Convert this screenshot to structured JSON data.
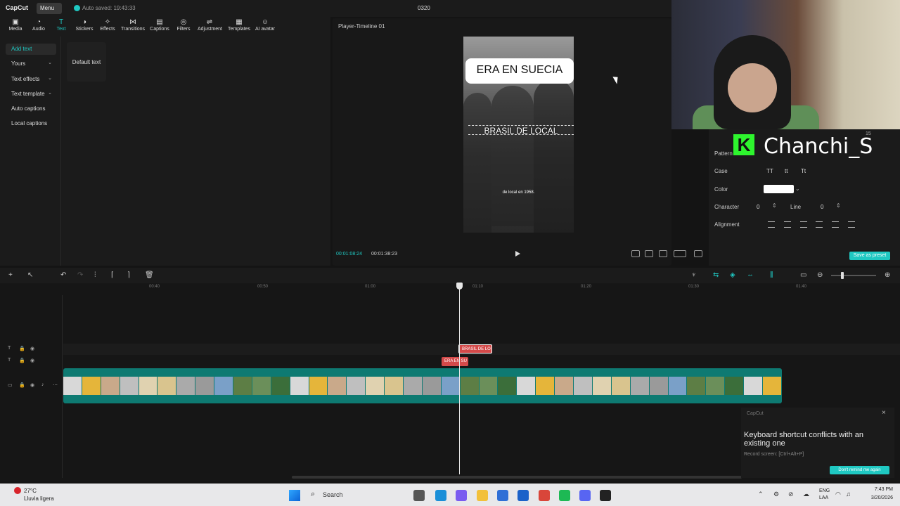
{
  "titlebar": {
    "logo": "CapCut",
    "menu_label": "Menu",
    "autosave": "Auto saved: 19:43:33",
    "project_name": "0320"
  },
  "toolbar": {
    "tools": [
      {
        "label": "Media",
        "icon": "media-icon",
        "glyph": "▣"
      },
      {
        "label": "Audio",
        "icon": "audio-icon",
        "glyph": "◔"
      },
      {
        "label": "Text",
        "icon": "text-icon",
        "glyph": "T"
      },
      {
        "label": "Stickers",
        "icon": "sticker-icon",
        "glyph": "◑"
      },
      {
        "label": "Effects",
        "icon": "effects-icon",
        "glyph": "✧"
      },
      {
        "label": "Transitions",
        "icon": "transitions-icon",
        "glyph": "⋈"
      },
      {
        "label": "Captions",
        "icon": "captions-icon",
        "glyph": "▤"
      },
      {
        "label": "Filters",
        "icon": "filters-icon",
        "glyph": "◎"
      },
      {
        "label": "Adjustment",
        "icon": "adjustment-icon",
        "glyph": "⇌"
      },
      {
        "label": "Templates",
        "icon": "templates-icon",
        "glyph": "▦"
      },
      {
        "label": "AI avatar",
        "icon": "ai-avatar-icon",
        "glyph": "☺"
      }
    ],
    "active": "Text"
  },
  "left_nav": {
    "items": [
      {
        "label": "Add text",
        "active": true,
        "chevron": false
      },
      {
        "label": "Yours",
        "active": false,
        "chevron": true
      },
      {
        "label": "Text effects",
        "active": false,
        "chevron": true
      },
      {
        "label": "Text template",
        "active": false,
        "chevron": true
      },
      {
        "label": "Auto captions",
        "active": false,
        "chevron": false
      },
      {
        "label": "Local captions",
        "active": false,
        "chevron": false
      }
    ],
    "default_card": "Default text"
  },
  "player": {
    "title": "Player-Timeline 01",
    "caption_main": "ERA EN SUECIA",
    "caption_secondary": "BRASIL DE LOCAL",
    "caption_small": "de local en 1958.",
    "time_current": "00:01:08:24",
    "time_total": "00:01:38:23"
  },
  "overlay": {
    "streamer_logo": "K",
    "streamer_name": "Chanchi_S"
  },
  "right_panel": {
    "pattern_label": "Pattern",
    "case_label": "Case",
    "case_options": [
      "TT",
      "tt",
      "Tt"
    ],
    "color_label": "Color",
    "color_value": "#ffffff",
    "character_label": "Character",
    "character_value": "0",
    "line_label": "Line",
    "line_value": "0",
    "alignment_label": "Alignment",
    "save_preset": "Save as preset",
    "size_value": "15"
  },
  "timeline": {
    "ruler": [
      "00:40",
      "00:50",
      "01:00",
      "01:10",
      "01:20",
      "01:30",
      "01:40"
    ],
    "text_clip_1": "BRASIL DE LO",
    "text_clip_2": "ERA EN SU"
  },
  "toast": {
    "app": "CapCut",
    "title": "Keyboard shortcut conflicts with an existing one",
    "subtitle": "Record screen: [Ctrl+Alt+P]",
    "button": "Don't remind me again"
  },
  "taskbar": {
    "weather_temp": "27°C",
    "weather_desc": "Lluvia ligera",
    "search_label": "Search",
    "lang_1": "ENG",
    "lang_2": "LAA",
    "time": "7:43 PM",
    "date": "3/20/2026",
    "apps": [
      {
        "name": "task-view-icon",
        "color": "#555555"
      },
      {
        "name": "edge-icon",
        "color": "#1a8fd8"
      },
      {
        "name": "copilot-icon",
        "color": "#7a5cf0"
      },
      {
        "name": "file-explorer-icon",
        "color": "#f2c03a"
      },
      {
        "name": "store-icon",
        "color": "#2f6fd6"
      },
      {
        "name": "mail-icon",
        "color": "#1b62c9"
      },
      {
        "name": "chrome-icon",
        "color": "#d9463a"
      },
      {
        "name": "spotify-icon",
        "color": "#1db954"
      },
      {
        "name": "discord-icon",
        "color": "#5865f2"
      },
      {
        "name": "capcut-icon",
        "color": "#222222"
      }
    ]
  },
  "colors": {
    "accent": "#1fc8c2",
    "text_clip": "#d44a4a",
    "video_track": "#0e7a72"
  }
}
